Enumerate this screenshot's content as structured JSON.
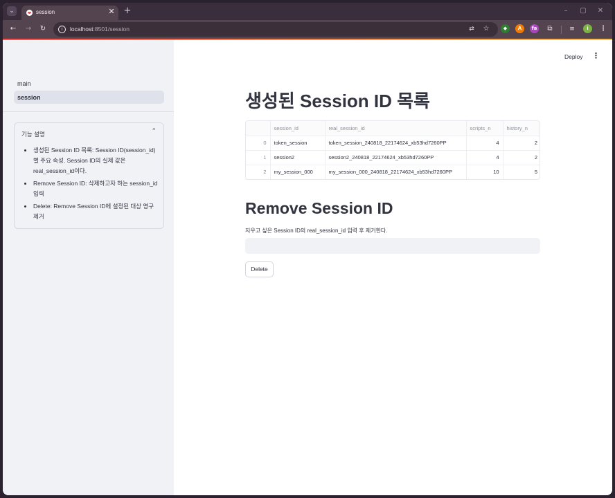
{
  "browser": {
    "tab_title": "session",
    "url_host": "localhost",
    "url_path": ":8501/session",
    "icons": {
      "tab_list": "chevron-down-icon",
      "tab_close": "close-icon",
      "new_tab": "plus-icon",
      "back": "arrow-left-icon",
      "forward": "arrow-right-icon",
      "reload": "reload-icon",
      "site_info": "info-icon",
      "translate": "translate-icon",
      "bookmark": "star-icon",
      "menu": "kebab-menu-icon"
    },
    "accent_gradient": [
      "#ff4b4b",
      "#ffbd45"
    ]
  },
  "sidebar": {
    "nav": [
      {
        "label": "main",
        "active": false
      },
      {
        "label": "session",
        "active": true
      }
    ],
    "expander": {
      "title": "기능 설명",
      "items": [
        "생성된 Session ID 목록: Session ID(session_id) 별 주요 속성. Session ID의 실제 값은 real_session_id이다.",
        "Remove Session ID: 삭제하고자 하는 session_id 입력",
        "Delete: Remove Session ID에 설정된 대상 영구 제거"
      ]
    }
  },
  "header": {
    "deploy_label": "Deploy"
  },
  "main": {
    "title": "생성된 Session ID 목록",
    "table": {
      "columns": [
        "",
        "session_id",
        "real_session_id",
        "scripts_n",
        "history_n"
      ],
      "rows": [
        [
          "0",
          "token_session",
          "token_session_240818_22174624_xb53hd7260PP",
          "4",
          "2"
        ],
        [
          "1",
          "session2",
          "session2_240818_22174624_xb53hd7260PP",
          "4",
          "2"
        ],
        [
          "2",
          "my_session_000",
          "my_session_000_240818_22174624_xb53hd7260PP",
          "10",
          "5"
        ]
      ]
    },
    "remove_title": "Remove Session ID",
    "remove_hint": "지우고 싶은 Session ID의 real_session_id 입력 후 제거한다.",
    "remove_input_value": "",
    "delete_label": "Delete"
  }
}
